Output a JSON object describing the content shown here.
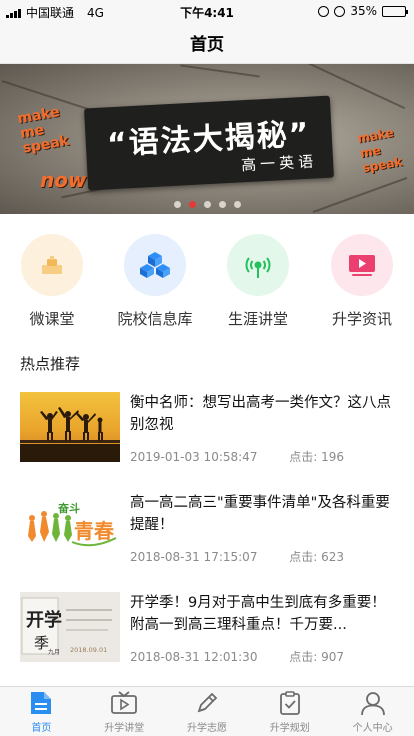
{
  "status_bar": {
    "carrier": "中国联通",
    "network": "4G",
    "time": "下午4:41",
    "battery": "35%",
    "battery_level": 0.35
  },
  "nav": {
    "title": "首页"
  },
  "banner": {
    "title": "“语法大揭秘”",
    "subtitle": "高一英语",
    "make_left": [
      "make",
      "me",
      "speak"
    ],
    "make_right": [
      "make",
      "me",
      "speak"
    ],
    "now": "now",
    "slide_count": 5,
    "active_slide": 1
  },
  "categories": [
    {
      "label": "微课堂",
      "icon": "micro-class-icon",
      "bg": "#fdf0dd",
      "color": "#f3c26b"
    },
    {
      "label": "院校信息库",
      "icon": "school-database-icon",
      "bg": "#e5effd",
      "color": "#2f8ef5"
    },
    {
      "label": "生涯讲堂",
      "icon": "career-lecture-icon",
      "bg": "#e3f8ea",
      "color": "#23c05d"
    },
    {
      "label": "升学资讯",
      "icon": "admission-news-icon",
      "bg": "#fde6ec",
      "color": "#ea3f6f"
    }
  ],
  "hot": {
    "title": "热点推荐",
    "articles": [
      {
        "title": "衡中名师：想写出高考一类作文？这八点别忽视",
        "date": "2019-01-03 10:58:47",
        "clicks": "点击: 196"
      },
      {
        "title": "高一高二高三\"重要事件清单\"及各科重要提醒！",
        "date": "2018-08-31 17:15:07",
        "clicks": "点击: 623"
      },
      {
        "title": "开学季！9月对于高中生到底有多重要！附高一到高三理科重点！千万要...",
        "date": "2018-08-31 12:01:30",
        "clicks": "点击: 907"
      }
    ],
    "thumb2_text": [
      "奋斗",
      "青春"
    ],
    "thumb3_text": [
      "开学",
      "季",
      "九月",
      "2018.09.01"
    ]
  },
  "tabs": [
    {
      "label": "首页",
      "icon": "home-doc-icon",
      "active": true
    },
    {
      "label": "升学讲堂",
      "icon": "video-tv-icon",
      "active": false
    },
    {
      "label": "升学志愿",
      "icon": "pencil-icon",
      "active": false
    },
    {
      "label": "升学规划",
      "icon": "clipboard-check-icon",
      "active": false
    },
    {
      "label": "个人中心",
      "icon": "person-icon",
      "active": false
    }
  ],
  "colors": {
    "accent": "#2a8ef0",
    "banner_accent": "#f36d2c",
    "dot_active": "#e53935"
  }
}
